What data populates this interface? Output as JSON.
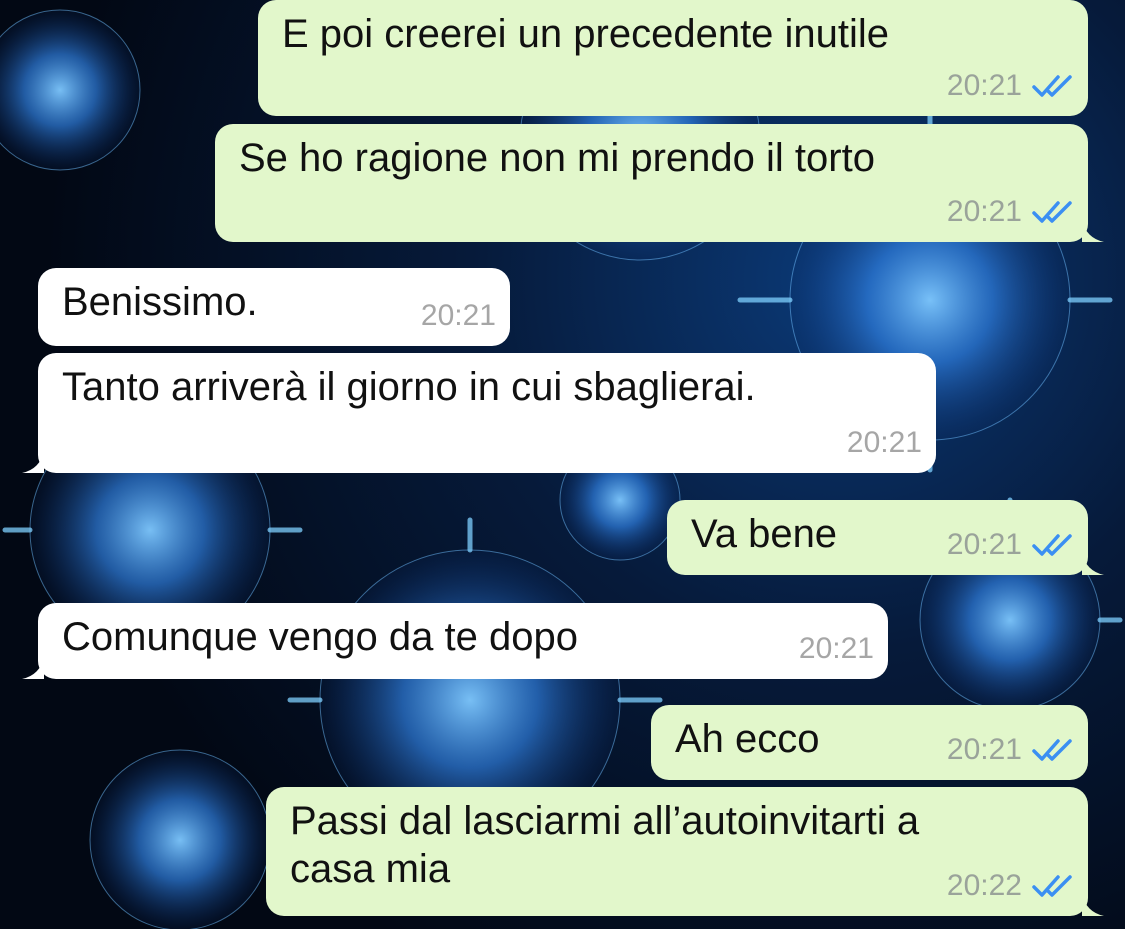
{
  "chat": {
    "messages": [
      {
        "text": "E poi creerei un precedente inutile",
        "time": "20:21",
        "direction": "outgoing",
        "status": "read"
      },
      {
        "text": "Se ho ragione non mi prendo il torto",
        "time": "20:21",
        "direction": "outgoing",
        "status": "read"
      },
      {
        "text": "Benissimo.",
        "time": "20:21",
        "direction": "incoming"
      },
      {
        "text": "Tanto arriverà il giorno in cui sbaglierai.",
        "time": "20:21",
        "direction": "incoming"
      },
      {
        "text": "Va bene",
        "time": "20:21",
        "direction": "outgoing",
        "status": "read"
      },
      {
        "text": "Comunque vengo da te dopo",
        "time": "20:21",
        "direction": "incoming"
      },
      {
        "text": "Ah ecco",
        "time": "20:21",
        "direction": "outgoing",
        "status": "read"
      },
      {
        "text": "Passi dal lasciarmi all’autoinvitarti a\ncasa mia",
        "time": "20:22",
        "direction": "outgoing",
        "status": "read"
      }
    ]
  },
  "theme": {
    "outgoing_bubble": "#e2f7cb",
    "incoming_bubble": "#ffffff",
    "read_tick_color": "#3b8ff2",
    "wallpaper": "blue virus particles on dark background"
  }
}
